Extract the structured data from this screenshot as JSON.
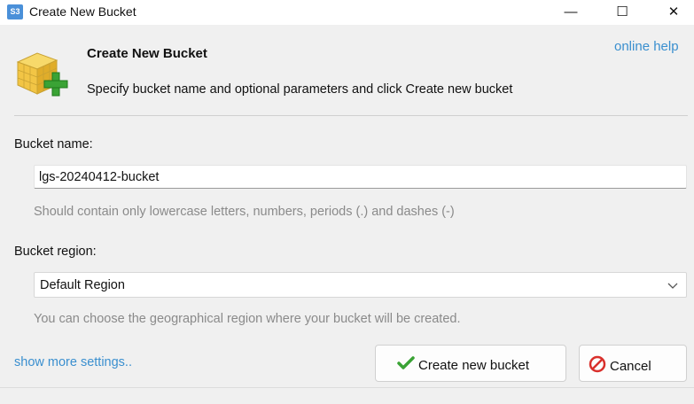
{
  "window": {
    "title": "Create New Bucket",
    "app_icon_text": "S3",
    "minimize_glyph": "—",
    "maximize_glyph": "☐",
    "close_glyph": "✕"
  },
  "header": {
    "title": "Create New Bucket",
    "description": "Specify bucket name and optional parameters and click Create new bucket",
    "online_help": "online help",
    "icon": "bucket-add-icon"
  },
  "bucket_name": {
    "label": "Bucket name:",
    "value": "lgs-20240412-bucket",
    "hint": "Should contain only lowercase letters, numbers, periods (.) and dashes (-)"
  },
  "bucket_region": {
    "label": "Bucket region:",
    "selected": "Default Region",
    "hint": "You can choose the geographical region where your bucket will be created."
  },
  "footer": {
    "more_settings": "show more settings..",
    "create_button": "Create new bucket",
    "cancel_button": "Cancel"
  },
  "colors": {
    "link": "#3a8fcf",
    "check_green": "#3aa335",
    "cancel_red": "#d9302c"
  }
}
